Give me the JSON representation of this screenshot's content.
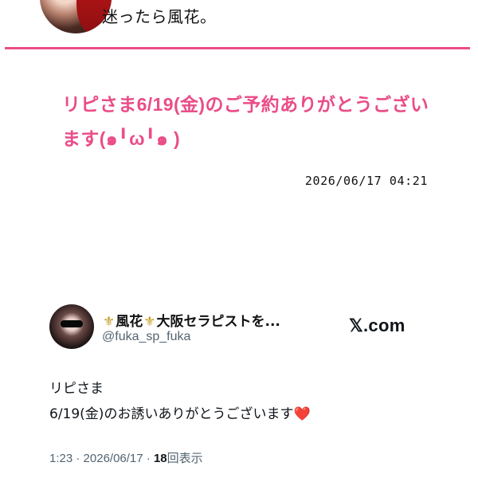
{
  "header": {
    "tagline": "迷ったら風花。"
  },
  "post": {
    "title": "リピさま6/19(金)のご予約ありがとうございます(๑╹ω╹๑ )",
    "timestamp": "2026/06/17 04:21"
  },
  "tweet": {
    "fleur_left": "⚜",
    "display_name_part1": "風花",
    "fleur_right": "⚜",
    "display_name_part2": "大阪セラピストを...",
    "handle": "@fuka_sp_fuka",
    "brand": "𝕏.com",
    "text_line1": "リピさま",
    "text_line2": "6/19(金)のお誘いありがとうございます",
    "heart": "❤️",
    "time": "1:23",
    "separator1": "·",
    "date": "2026/06/17",
    "separator2": "·",
    "views_count": "18",
    "views_label": "回表示"
  },
  "colors": {
    "accent_pink": "#ea4d88",
    "heart_red": "#e2262e",
    "meta_gray": "#536471"
  }
}
